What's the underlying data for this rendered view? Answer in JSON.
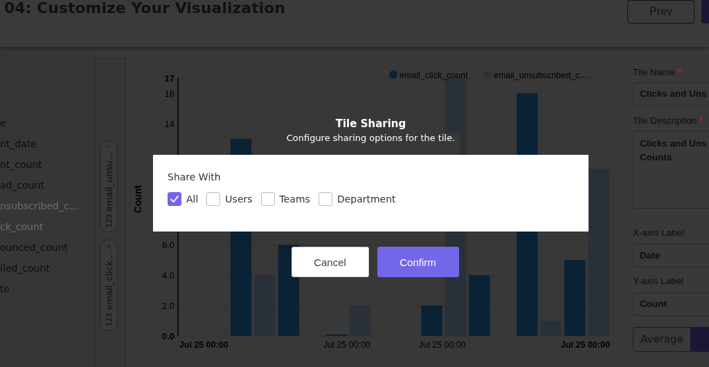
{
  "header": {
    "title": "04: Customize Your Visualization",
    "prev_label": "Prev"
  },
  "fields": [
    {
      "label": "e",
      "disabled": false
    },
    {
      "label": "nt_date",
      "disabled": false
    },
    {
      "label": "nt_count",
      "disabled": false
    },
    {
      "label": "ad_count",
      "disabled": false
    },
    {
      "label": "nsubscribed_c...",
      "disabled": true
    },
    {
      "label": "ck_count",
      "disabled": true
    },
    {
      "label": "ounced_count",
      "disabled": false
    },
    {
      "label": "iled_count",
      "disabled": false
    },
    {
      "label": "te",
      "disabled": false
    }
  ],
  "drop_chips": [
    {
      "type_tag": "123",
      "label": "email_unsu..."
    },
    {
      "type_tag": "123",
      "label": "email_click..."
    }
  ],
  "chart": {
    "chart_data": {
      "type": "bar",
      "ylabel": "Count",
      "categories": [
        "Jul 25 00:00",
        null,
        null,
        "Jul 25 00:00",
        null,
        "Jul 25 00:00",
        null,
        null,
        "Jul 25 00:00"
      ],
      "series": [
        {
          "name": "email_click_count",
          "color": "#0a2236",
          "values": [
            null,
            13,
            6,
            0.1,
            null,
            2,
            4,
            16,
            5
          ]
        },
        {
          "name": "email_unsubscribed_c...",
          "color": "#2a3038",
          "values": [
            0,
            4,
            0,
            2,
            null,
            17,
            null,
            1,
            11
          ]
        }
      ],
      "ylim": [
        0,
        17
      ],
      "legend": true,
      "yticks": [
        {
          "value": 0,
          "label": "0.0"
        },
        {
          "value": 2,
          "label": "2.0"
        },
        {
          "value": 4,
          "label": "4.0"
        },
        {
          "value": 6,
          "label": "6.0"
        },
        14,
        16,
        17
      ]
    }
  },
  "settings": [
    {
      "kind": "input",
      "label": "Tile Name",
      "required_mark": "*",
      "value_lines": [
        "Clicks and Uns"
      ]
    },
    {
      "kind": "textarea",
      "label": "Tile Description",
      "required_mark": "*",
      "value_lines": [
        "Clicks and Uns",
        "Counts"
      ]
    },
    {
      "kind": "input",
      "label": "X-axis Label",
      "value_lines": [
        "Date"
      ]
    },
    {
      "kind": "input",
      "label": "Y-axis Label",
      "value_lines": [
        "Count"
      ]
    }
  ],
  "aggregation": [
    {
      "label": "Average",
      "selected": false
    },
    {
      "selected": true
    }
  ],
  "dialog": {
    "title": "Tile Sharing",
    "subtitle": "Configure sharing options for the tile.",
    "section_label": "Share With",
    "options": [
      {
        "label": "All",
        "checked": true
      },
      {
        "label": "Users",
        "checked": false
      },
      {
        "label": "Teams",
        "checked": false
      },
      {
        "label": "Department",
        "checked": false
      }
    ],
    "buttons": [
      {
        "label": "Cancel",
        "kind": "secondary"
      },
      {
        "label": "Confirm",
        "kind": "primary"
      }
    ]
  }
}
